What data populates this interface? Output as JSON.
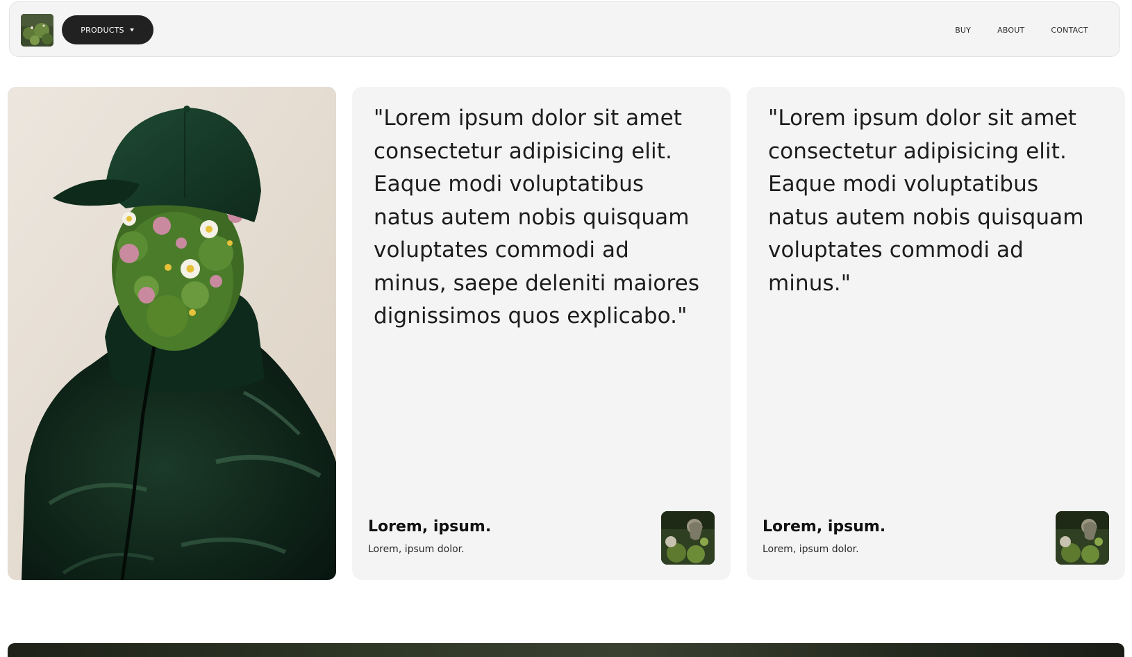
{
  "navbar": {
    "logo_alt": "logo",
    "products_label": "PRODUCTS",
    "links": [
      {
        "label": "BUY"
      },
      {
        "label": "ABOUT"
      },
      {
        "label": "CONTACT"
      }
    ]
  },
  "hero": {
    "image_alt": "person in green cap and puffer jacket with face covered in flowers and moss"
  },
  "testimonials": [
    {
      "quote": "\"Lorem ipsum dolor sit amet consectetur adipisicing elit. Eaque modi voluptatibus natus autem nobis quisquam voluptates commodi ad minus, saepe deleniti maiores dignissimos quos explicabo.\"",
      "author": "Lorem, ipsum.",
      "subtitle": "Lorem, ipsum dolor.",
      "avatar_alt": "avatar"
    },
    {
      "quote": "\"Lorem ipsum dolor sit amet consectetur adipisicing elit. Eaque modi voluptatibus natus autem nobis quisquam voluptates commodi ad minus.\"",
      "author": "Lorem, ipsum.",
      "subtitle": "Lorem, ipsum dolor.",
      "avatar_alt": "avatar"
    }
  ],
  "colors": {
    "navbar_bg": "#f4f4f4",
    "button_bg": "#212121",
    "card_bg": "#f4f4f4",
    "text": "#1c1c1c",
    "jacket_green": "#0e2a1c"
  },
  "icons": {
    "caret": "caret-down-icon"
  }
}
